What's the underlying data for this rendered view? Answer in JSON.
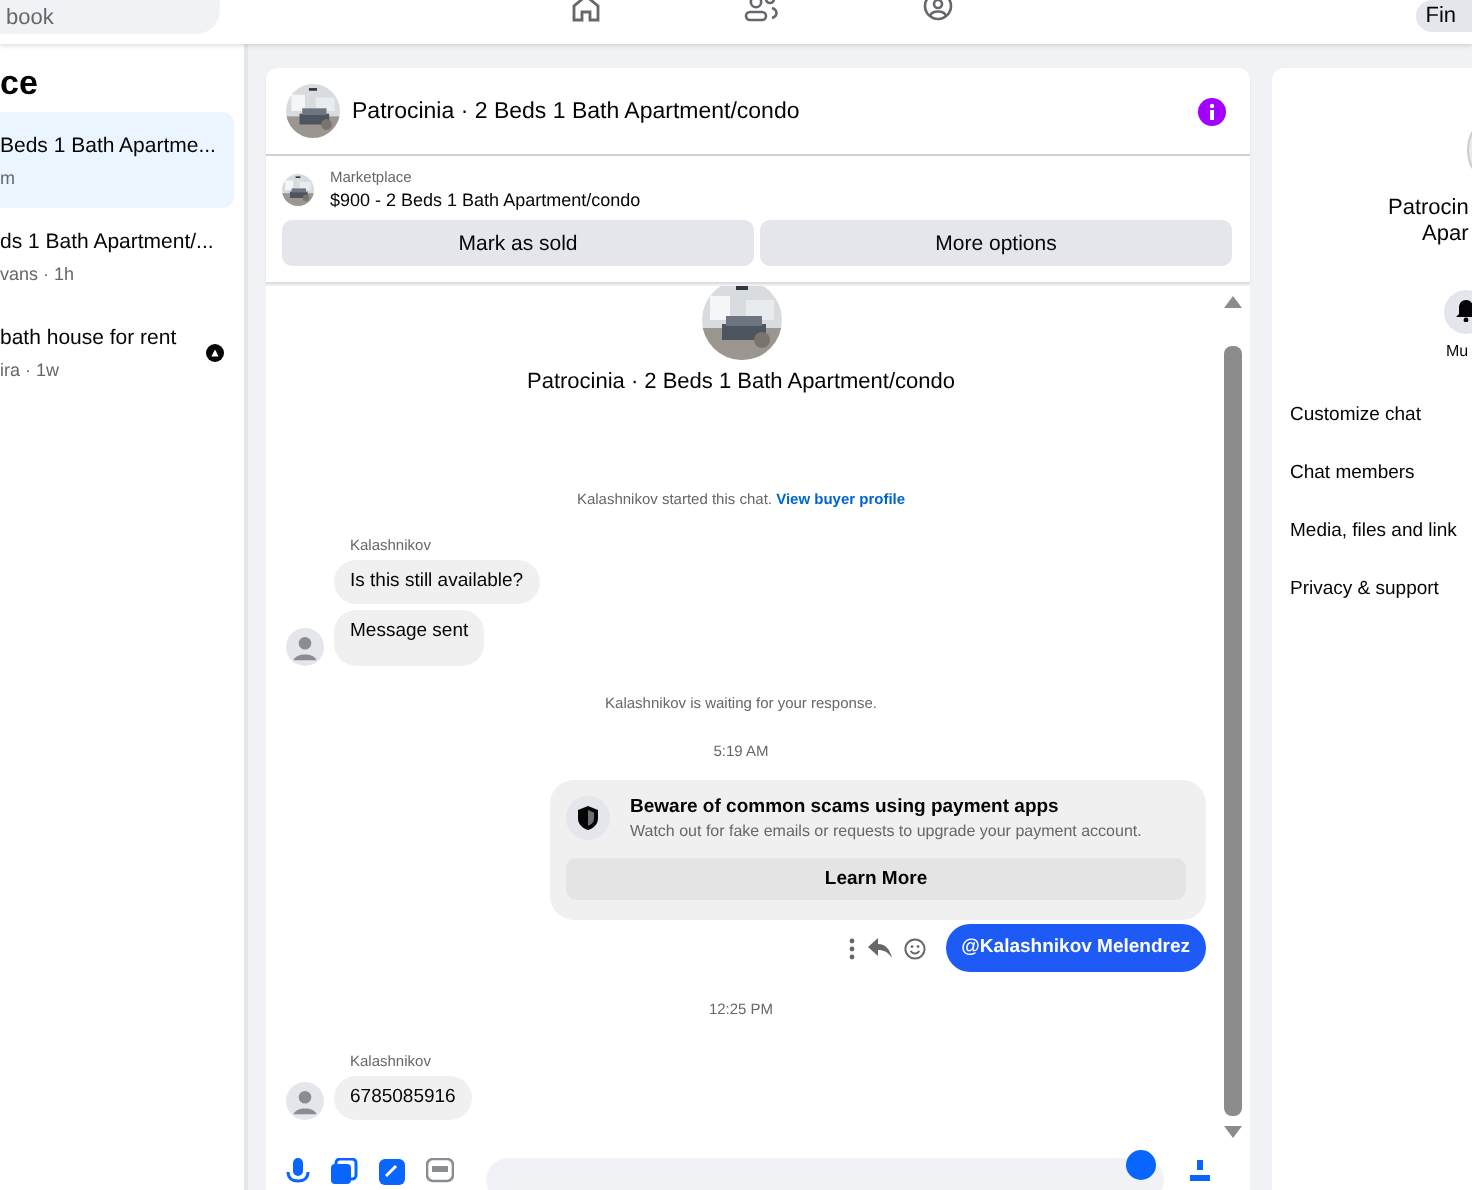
{
  "top_bar": {
    "search": {
      "value": "book"
    },
    "find_button": "Fin"
  },
  "sidebar": {
    "title": "ce",
    "items": [
      {
        "title": "Beds 1 Bath Apartme...",
        "subtitle": "m",
        "selected": true,
        "badge": false
      },
      {
        "title": "ds 1 Bath Apartment/...",
        "subtitle": "vans · 1h",
        "selected": false,
        "badge": false
      },
      {
        "title": "bath house for rent",
        "subtitle": "ira · 1w",
        "selected": false,
        "badge": true
      }
    ]
  },
  "conversation": {
    "title": "Patrocinia · 2 Beds 1 Bath Apartment/condo",
    "listing": {
      "label": "Marketplace",
      "title": "$900 - 2 Beds 1 Bath Apartment/condo"
    },
    "actions": [
      "Mark as sold",
      "More options"
    ],
    "intro_title": "Patrocinia · 2 Beds 1 Bath Apartment/condo",
    "messages": [
      {
        "kind": "system",
        "text": "Kalashnikov started this chat.",
        "link": "View buyer profile"
      },
      {
        "kind": "incoming",
        "sender": "Kalashnikov",
        "bubbles": [
          "Is this still available?",
          "Message sent"
        ]
      },
      {
        "kind": "system",
        "text": "Kalashnikov is waiting for your response."
      },
      {
        "kind": "time",
        "text": "5:19 AM"
      },
      {
        "kind": "notice",
        "title": "Beware of common scams using payment apps",
        "body": "Watch out for fake emails or requests to upgrade your payment account.",
        "button": "Learn More"
      },
      {
        "kind": "outgoing",
        "text": "@Kalashnikov Melendrez"
      },
      {
        "kind": "time",
        "text": "12:25 PM"
      },
      {
        "kind": "incoming",
        "sender": "Kalashnikov",
        "bubbles": [
          "6785085916"
        ]
      }
    ]
  },
  "details": {
    "name_lines": [
      "Patrocin",
      "Apar"
    ],
    "mute_label": "Mu",
    "menu": [
      "Customize chat",
      "Chat members",
      "Media, files and link",
      "Privacy & support"
    ]
  }
}
